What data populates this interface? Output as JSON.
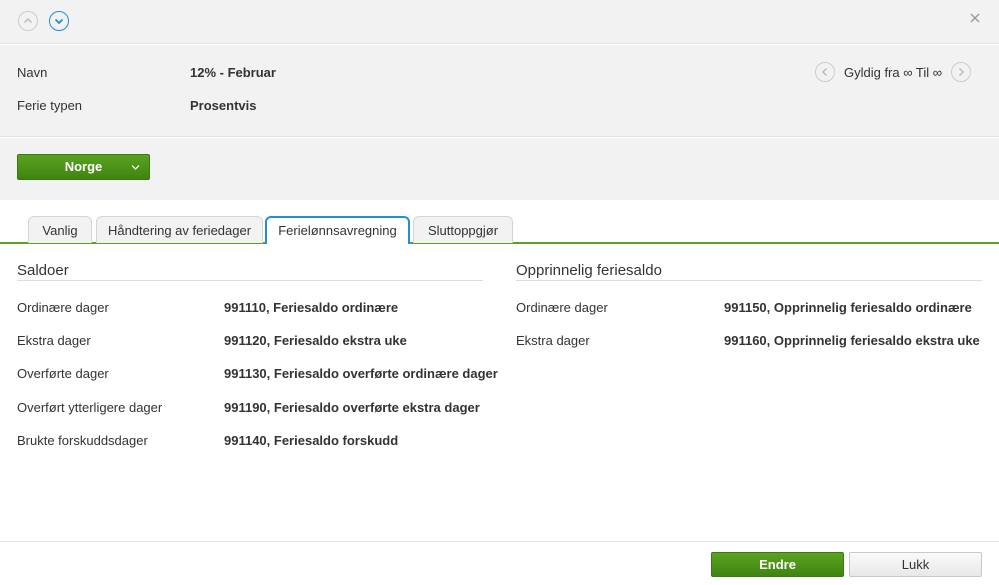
{
  "header": {
    "fields": [
      {
        "label": "Navn",
        "value": "12% - Februar"
      },
      {
        "label": "Ferie typen",
        "value": "Prosentvis"
      }
    ],
    "validity_text": "Gyldig fra ∞ Til ∞"
  },
  "country_button": {
    "label": "Norge"
  },
  "tabs": [
    {
      "label": "Vanlig",
      "active": false
    },
    {
      "label": "Håndtering av feriedager",
      "active": false
    },
    {
      "label": "Ferielønnsavregning",
      "active": true
    },
    {
      "label": "Sluttoppgjør",
      "active": false
    }
  ],
  "saldoer": {
    "title": "Saldoer",
    "rows": [
      {
        "label": "Ordinære dager",
        "value": "991110, Feriesaldo ordinære"
      },
      {
        "label": "Ekstra dager",
        "value": "991120, Feriesaldo ekstra uke"
      },
      {
        "label": "Overførte dager",
        "value": "991130, Feriesaldo overførte ordinære dager"
      },
      {
        "label": "Overført ytterligere dager",
        "value": "991190, Feriesaldo overførte ekstra dager"
      },
      {
        "label": "Brukte forskuddsdager",
        "value": "991140, Feriesaldo forskudd"
      }
    ]
  },
  "opprinnelig": {
    "title": "Opprinnelig feriesaldo",
    "rows": [
      {
        "label": "Ordinære dager",
        "value": "991150, Opprinnelig feriesaldo ordinære"
      },
      {
        "label": "Ekstra dager",
        "value": "991160, Opprinnelig feriesaldo ekstra uke"
      }
    ]
  },
  "footer": {
    "primary_label": "Endre",
    "secondary_label": "Lukk"
  },
  "colors": {
    "accent_green": "#4a9418",
    "accent_blue": "#1f8fd6",
    "panel_bg": "#f2f2f2"
  }
}
